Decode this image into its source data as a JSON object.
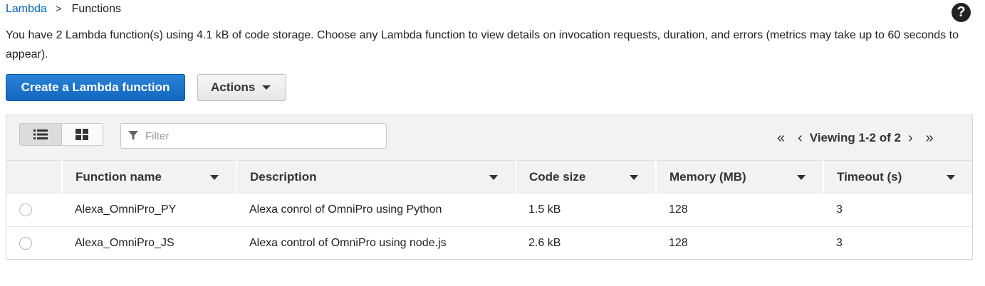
{
  "breadcrumb": {
    "root": "Lambda",
    "separator": ">",
    "current": "Functions"
  },
  "help_label": "?",
  "intro_text": "You have 2 Lambda function(s) using 4.1 kB of code storage. Choose any Lambda function to view details on invocation requests, duration, and errors (metrics may take up to 60 seconds to appear).",
  "toolbar": {
    "create_label": "Create a Lambda function",
    "actions_label": "Actions"
  },
  "filter": {
    "placeholder": "Filter",
    "value": ""
  },
  "pager": {
    "first": "«",
    "prev": "‹",
    "text": "Viewing 1-2 of 2",
    "next": "›",
    "last": "»"
  },
  "table": {
    "columns": [
      "Function name",
      "Description",
      "Code size",
      "Memory (MB)",
      "Timeout (s)"
    ],
    "rows": [
      {
        "name": "Alexa_OmniPro_PY",
        "description": "Alexa conrol of OmniPro using Python",
        "code_size": "1.5 kB",
        "memory": "128",
        "timeout": "3"
      },
      {
        "name": "Alexa_OmniPro_JS",
        "description": "Alexa control of OmniPro using node.js",
        "code_size": "2.6 kB",
        "memory": "128",
        "timeout": "3"
      }
    ]
  },
  "colors": {
    "primary": "#1266c0",
    "link": "#0066c0",
    "toolbar_bg": "#f2f2f2"
  },
  "icons": [
    "help-icon",
    "list-view-icon",
    "grid-view-icon",
    "filter-icon",
    "first-page-icon",
    "prev-page-icon",
    "next-page-icon",
    "last-page-icon",
    "chevron-down-icon",
    "sort-caret-icon"
  ]
}
